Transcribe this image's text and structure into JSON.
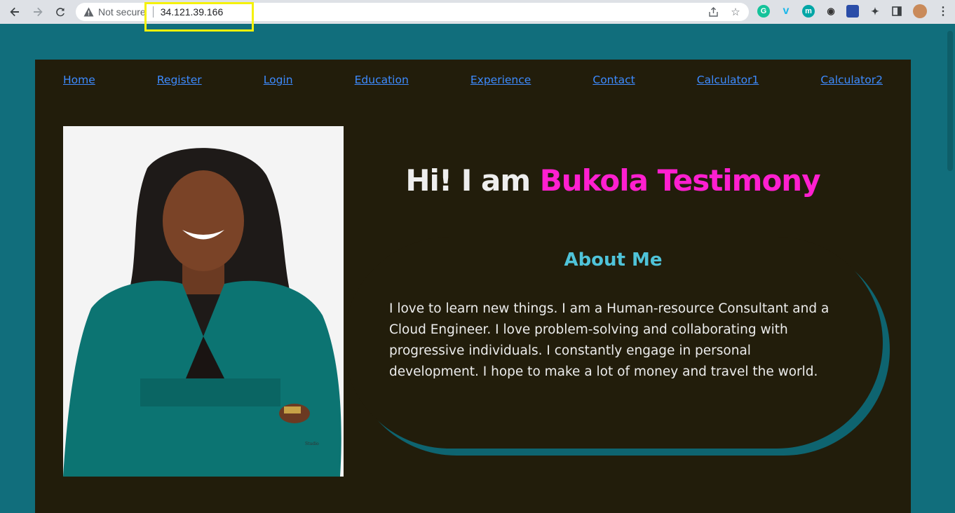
{
  "browser": {
    "security_label": "Not secure",
    "url": "34.121.39.166"
  },
  "nav": {
    "links": [
      "Home",
      "Register",
      "Login",
      "Education",
      "Experience",
      "Contact",
      "Calculator1",
      "Calculator2"
    ]
  },
  "hero": {
    "title_prefix": "Hi! I am",
    "title_name": "Bukola Testimony"
  },
  "about": {
    "heading": "About Me",
    "body": "I love to learn new things. I am a Human-resource Consultant and a Cloud Engineer. I love problem-solving and collaborating with progressive individuals. I constantly engage in personal development. I hope to make a lot of money and travel the world."
  },
  "colors": {
    "page_bg": "#116e7c",
    "card_bg": "#221d0b",
    "link": "#3d8bff",
    "name_accent": "#ff1fd0",
    "heading_accent": "#4fc3d9"
  },
  "icons": [
    "back-icon",
    "forward-icon",
    "reload-icon",
    "warning-icon",
    "share-icon",
    "star-icon",
    "grammarly-icon",
    "vimeo-icon",
    "extension-m-icon",
    "spy-icon",
    "extension-icon",
    "puzzle-icon",
    "sidepanel-icon",
    "profile-avatar",
    "menu-icon"
  ]
}
